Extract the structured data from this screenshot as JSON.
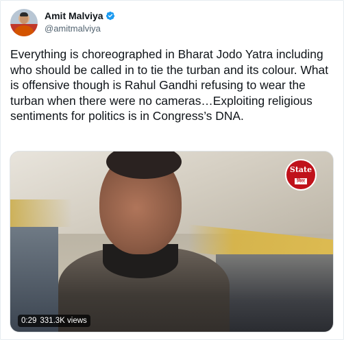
{
  "author": {
    "display_name": "Amit Malviya",
    "handle": "@amitmalviya",
    "verified": true,
    "verified_color": "#1d9bf0"
  },
  "tweet": {
    "text": "Everything is choreographed in Bharat Jodo Yatra including who should be called in to tie the turban and its colour. What is offensive though is Rahul Gandhi refusing to wear the turban when there were no cameras…Exploiting religious sentiments for politics is in Congress’s DNA."
  },
  "media": {
    "type": "video",
    "duration": "0:29",
    "views": "331.3K views",
    "watermark": {
      "line1": "State",
      "line2": "मिरर",
      "color": "#c0121b"
    }
  }
}
